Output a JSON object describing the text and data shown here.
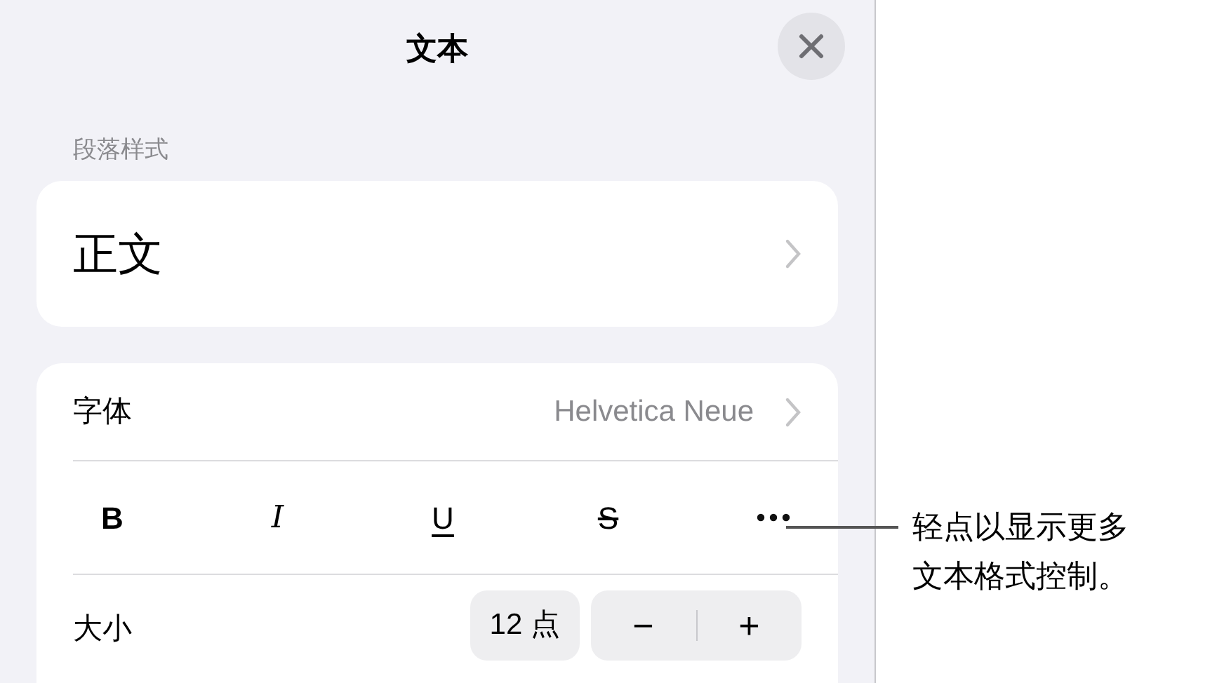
{
  "panel": {
    "title": "文本",
    "section_label": "段落样式",
    "paragraph_style": "正文",
    "font": {
      "label": "字体",
      "value": "Helvetica Neue"
    },
    "styles": [
      {
        "kind": "bold",
        "label": "B"
      },
      {
        "kind": "italic",
        "label": "I"
      },
      {
        "kind": "underline",
        "label": "U"
      },
      {
        "kind": "strikethrough",
        "label": "S"
      },
      {
        "kind": "more"
      }
    ],
    "size": {
      "label": "大小",
      "value": "12 点",
      "decrease": "−",
      "increase": "+"
    }
  },
  "callout": {
    "lines": [
      "轻点以显示更多",
      "文本格式控制。"
    ]
  }
}
